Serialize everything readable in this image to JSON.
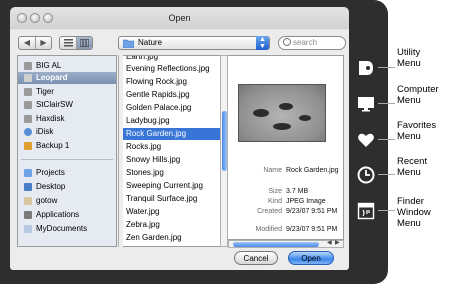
{
  "window": {
    "title": "Open"
  },
  "toolbar": {
    "back_icon": "arrow-left-icon",
    "forward_icon": "arrow-right-icon",
    "location": "Nature",
    "search_placeholder": "search"
  },
  "sidebar": {
    "devices": [
      {
        "label": "BIG AL",
        "icon": "hard-drive-icon"
      },
      {
        "label": "Leopard",
        "icon": "hard-drive-icon",
        "selected": true
      },
      {
        "label": "Tiger",
        "icon": "hard-drive-icon"
      },
      {
        "label": "StClairSW",
        "icon": "hard-drive-icon"
      },
      {
        "label": "Haxdisk",
        "icon": "hard-drive-icon"
      },
      {
        "label": "iDisk",
        "icon": "idisk-icon"
      },
      {
        "label": "Backup 1",
        "icon": "hard-drive-icon"
      }
    ],
    "places": [
      {
        "label": "Projects",
        "icon": "folder-icon"
      },
      {
        "label": "Desktop",
        "icon": "desktop-folder-icon"
      },
      {
        "label": "gotow",
        "icon": "home-icon"
      },
      {
        "label": "Applications",
        "icon": "applications-icon"
      },
      {
        "label": "MyDocuments",
        "icon": "documents-icon"
      }
    ]
  },
  "files": [
    "Earth.jpg",
    "Evening Reflections.jpg",
    "Flowing Rock.jpg",
    "Gentle Rapids.jpg",
    "Golden Palace.jpg",
    "Ladybug.jpg",
    "Rock Garden.jpg",
    "Rocks.jpg",
    "Snowy Hills.jpg",
    "Stones.jpg",
    "Sweeping Current.jpg",
    "Tranquil Surface.jpg",
    "Water.jpg",
    "Zebra.jpg",
    "Zen Garden.jpg"
  ],
  "selected_file_index": 6,
  "preview": {
    "labels": {
      "name": "Name",
      "size": "Size",
      "kind": "Kind",
      "created": "Created",
      "modified": "Modified"
    },
    "values": {
      "name": "Rock Garden.jpg",
      "size": "3.7 MB",
      "kind": "JPEG Image",
      "created": "9/23/07 9:51 PM",
      "modified": "9/23/07 9:51 PM"
    }
  },
  "buttons": {
    "cancel": "Cancel",
    "open": "Open"
  },
  "callouts": {
    "utility": "Utility Menu",
    "computer": "Computer Menu",
    "favorites": "Favorites Menu",
    "recent": "Recent Menu",
    "finder": "Finder Window Menu"
  },
  "callout_lines": {
    "utility": [
      "Utility",
      "Menu"
    ],
    "computer": [
      "Computer",
      "Menu"
    ],
    "favorites": [
      "Favorites",
      "Menu"
    ],
    "recent": [
      "Recent",
      "Menu"
    ],
    "finder": [
      "Finder",
      "Window",
      "Menu"
    ]
  },
  "side_icons": [
    "utility-tag-icon",
    "computer-monitor-icon",
    "heart-icon",
    "clock-icon",
    "finder-window-icon"
  ],
  "colors": {
    "selection": "#3875d7",
    "sidebar_selection": "#7b91b2",
    "panel": "#2e2e2e",
    "default_button": "#3a86ea"
  }
}
